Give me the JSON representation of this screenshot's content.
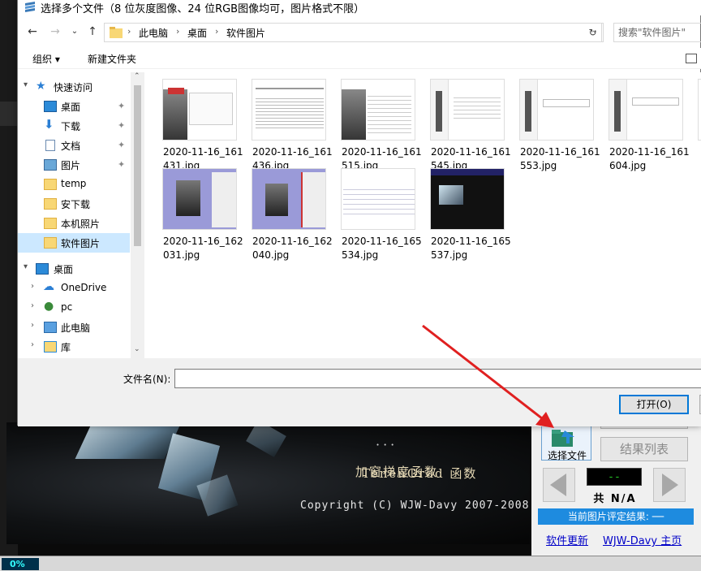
{
  "dialog": {
    "title": "选择多个文件（8 位灰度图像、24 位RGB图像均可，图片格式不限）",
    "breadcrumb": [
      "此电脑",
      "桌面",
      "软件图片"
    ],
    "search_placeholder": "搜索\"软件图片\"",
    "toolbar": {
      "organize": "组织 ▾",
      "new_folder": "新建文件夹"
    },
    "nav": {
      "quick_access": "快速访问",
      "quick_items": [
        "桌面",
        "下载",
        "文档",
        "图片",
        "temp",
        "安下载",
        "本机照片",
        "软件图片"
      ],
      "desktop": "桌面",
      "desktop_items": [
        "OneDrive",
        "pc",
        "此电脑",
        "库"
      ]
    },
    "files": [
      "2020-11-16_161431.jpg",
      "2020-11-16_161436.jpg",
      "2020-11-16_161515.jpg",
      "2020-11-16_161545.jpg",
      "2020-11-16_161553.jpg",
      "2020-11-16_161604.jpg",
      "2020-11-16_162031.jpg",
      "2020-11-16_162040.jpg",
      "2020-11-16_165534.jpg",
      "2020-11-16_165537.jpg"
    ],
    "filename_label": "文件名(N):",
    "filename_value": "",
    "open_button": "打开(O)"
  },
  "app": {
    "splash_line1": "加窗梯度函数",
    "splash_line2": "TenenGrad 函数",
    "copyright": "Copyright (C) WJW-Davy 2007-2008",
    "select_file": "选择文件",
    "result_list": "结果列表",
    "counter": "--",
    "count_label": "共 N/A 张",
    "result_bar": "当前图片评定结果: ──",
    "link_update": "软件更新",
    "link_home": "WJW-Davy 主页",
    "progress": "0%"
  }
}
